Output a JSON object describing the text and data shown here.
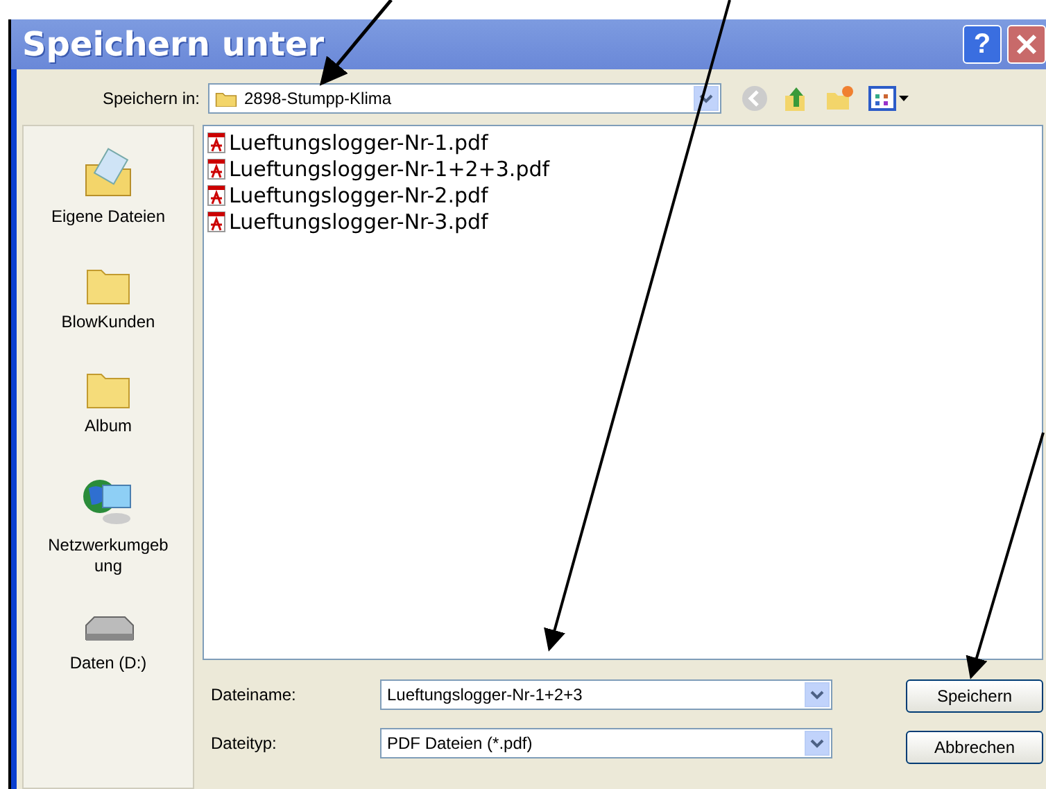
{
  "window": {
    "title": "Speichern unter",
    "help_button": "?"
  },
  "location": {
    "label": "Speichern in:",
    "value": "2898-Stumpp-Klima"
  },
  "places": [
    {
      "label": "Eigene Dateien",
      "kind": "documents"
    },
    {
      "label": "BlowKunden",
      "kind": "folder"
    },
    {
      "label": "Album",
      "kind": "folder"
    },
    {
      "label": "Netzwerkumgeb ung",
      "kind": "network"
    },
    {
      "label": "Daten (D:)",
      "kind": "drive"
    }
  ],
  "files": [
    {
      "name": "Lueftungslogger-Nr-1.pdf"
    },
    {
      "name": "Lueftungslogger-Nr-1+2+3.pdf"
    },
    {
      "name": "Lueftungslogger-Nr-2.pdf"
    },
    {
      "name": "Lueftungslogger-Nr-3.pdf"
    }
  ],
  "filename": {
    "label": "Dateiname:",
    "value": "Lueftungslogger-Nr-1+2+3"
  },
  "filetype": {
    "label": "Dateityp:",
    "value": "PDF Dateien (*.pdf)"
  },
  "buttons": [
    "Speichern",
    "Abbrechen"
  ]
}
